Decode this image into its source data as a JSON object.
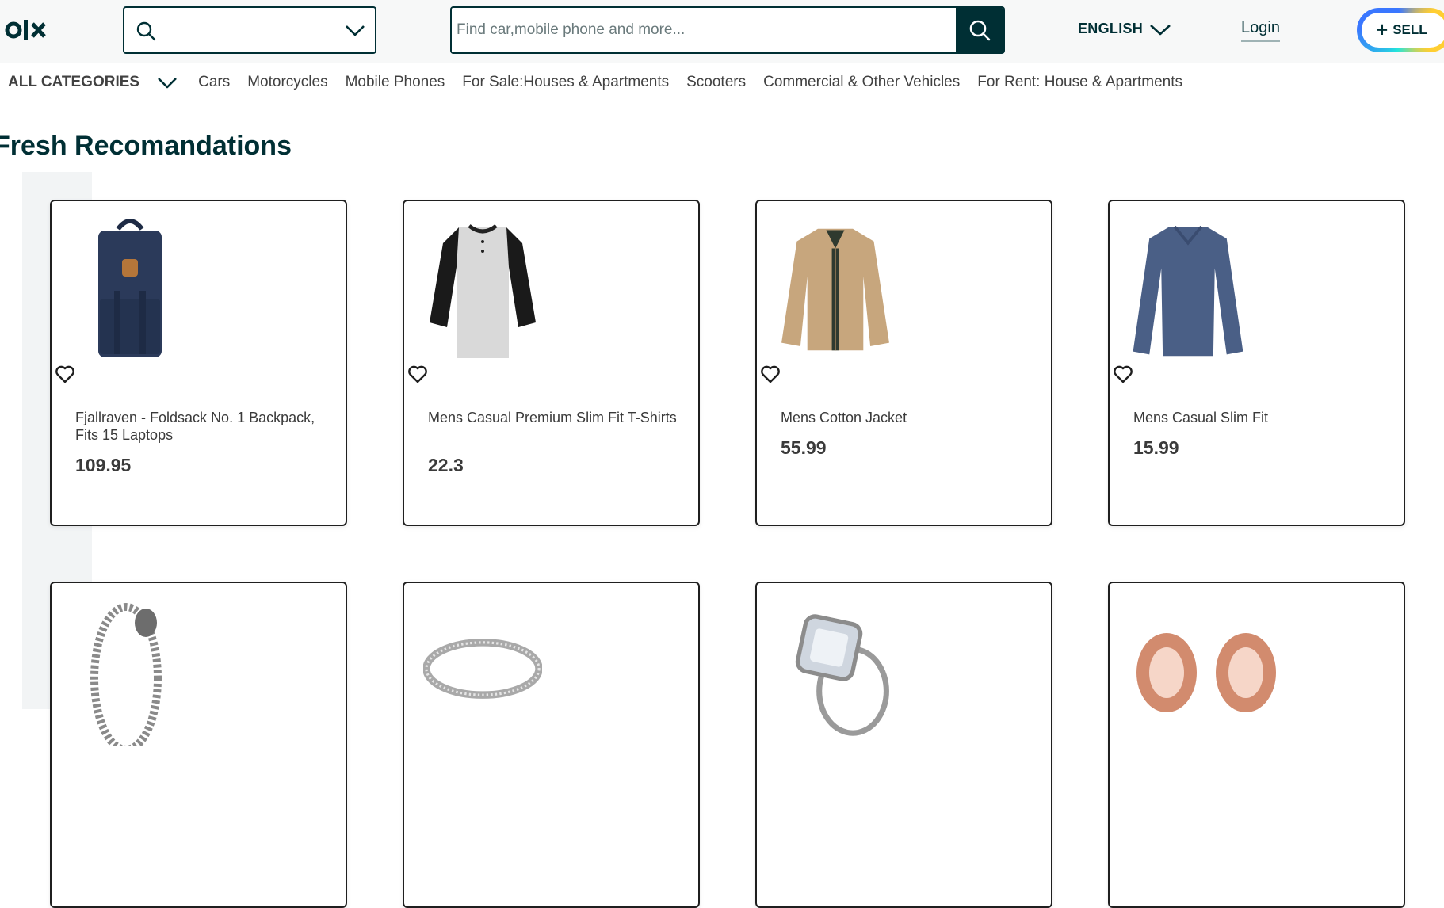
{
  "header": {
    "logo_text": "olx",
    "location_value": "",
    "search_placeholder": "Find car,mobile phone and more...",
    "language": "ENGLISH",
    "login": "Login",
    "sell": "SELL"
  },
  "categories": {
    "all": "ALL CATEGORIES",
    "items": [
      "Cars",
      "Motorcycles",
      "Mobile Phones",
      "For Sale:Houses & Apartments",
      "Scooters",
      "Commercial & Other Vehicles",
      "For Rent: House & Apartments"
    ]
  },
  "section": {
    "title": "Fresh Recomandations"
  },
  "products": [
    {
      "title": "Fjallraven - Foldsack No. 1 Backpack, Fits 15 Laptops",
      "price": "109.95",
      "icon": "backpack-icon"
    },
    {
      "title": "Mens Casual Premium Slim Fit T-Shirts",
      "price": "22.3",
      "icon": "tshirt-icon"
    },
    {
      "title": "Mens Cotton Jacket",
      "price": "55.99",
      "icon": "jacket-icon"
    },
    {
      "title": "Mens Casual Slim Fit",
      "price": "15.99",
      "icon": "longsleeve-icon"
    },
    {
      "title": "",
      "price": "",
      "icon": "bracelet-icon"
    },
    {
      "title": "",
      "price": "",
      "icon": "ring-icon"
    },
    {
      "title": "",
      "price": "",
      "icon": "diamond-ring-icon"
    },
    {
      "title": "",
      "price": "",
      "icon": "ear-plugs-icon"
    }
  ],
  "colors": {
    "primary": "#002f34",
    "topbar": "#f7f8f8",
    "text": "#3a3a3a"
  }
}
